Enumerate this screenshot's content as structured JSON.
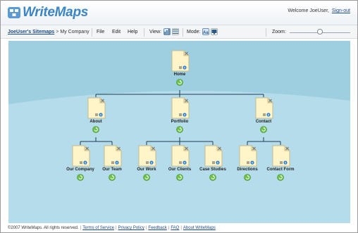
{
  "app": {
    "logo_text": "WriteMaps",
    "welcome_text": "Welcome JoeUser,",
    "signout_label": "Sign-out"
  },
  "toolbar": {
    "breadcrumb_link": "JoeUser's Sitemaps",
    "breadcrumb_sep": ">",
    "breadcrumb_current": "My Company",
    "menu": [
      "File",
      "Edit",
      "Help"
    ],
    "view_label": "View:",
    "mode_label": "Mode:",
    "zoom_label": "Zoom:",
    "zoom_level": 0.45,
    "view_buttons": [
      "tree-view-icon",
      "list-view-icon"
    ],
    "mode_buttons": [
      "text-mode-icon",
      "screen-mode-icon"
    ]
  },
  "sitemap": {
    "root": "Home",
    "level1": [
      "About",
      "Portfolio",
      "Contact"
    ],
    "level2": [
      "Our Company",
      "Our Team",
      "Our Work",
      "Our Clients",
      "Case Studies",
      "Directions",
      "Contact Form"
    ]
  },
  "footer": {
    "copyright": "©2007 WriteMaps. All rights reserved.",
    "links": [
      "Terms of Service",
      "Privacy Policy",
      "Feedback",
      "FAQ",
      "About WriteMaps"
    ]
  },
  "colors": {
    "brand": "#3d84c4",
    "canvas": "#9ecfe0",
    "page_fill": "#fff5c8",
    "add_icon": "#6cc04a",
    "info_icon": "#2f7fd0"
  }
}
